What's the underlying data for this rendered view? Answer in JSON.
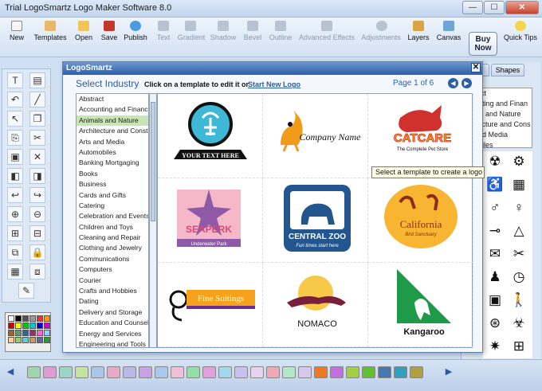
{
  "window": {
    "title": "Trial LogoSmartz Logo Maker Software 8.0",
    "min": "—",
    "max": "☐",
    "close": "✕"
  },
  "toolbar": {
    "items": [
      {
        "label": "New",
        "enabled": true
      },
      {
        "label": "Templates",
        "enabled": true
      },
      {
        "label": "Open",
        "enabled": true
      },
      {
        "label": "Save",
        "enabled": true
      },
      {
        "label": "Publish",
        "enabled": true
      },
      {
        "label": "Text",
        "enabled": false
      },
      {
        "label": "Gradient",
        "enabled": false
      },
      {
        "label": "Shadow",
        "enabled": false
      },
      {
        "label": "Bevel",
        "enabled": false
      },
      {
        "label": "Outline",
        "enabled": false
      },
      {
        "label": "Advanced Effects",
        "enabled": false
      },
      {
        "label": "Adjustments",
        "enabled": false
      },
      {
        "label": "Layers",
        "enabled": true
      },
      {
        "label": "Canvas",
        "enabled": true
      }
    ],
    "buy_now": "Buy Now",
    "quick_tips": "Quick Tips"
  },
  "right_panel": {
    "tab_shapes": "Shapes",
    "categories": [
      "ract",
      "unting and Finan",
      "als and Nature",
      "itecture and Cons",
      "and Media",
      "obiles"
    ],
    "symbols": [
      "☢",
      "⚙",
      "♿",
      "▦",
      "♂",
      "♀",
      "⊸",
      "△",
      "✉",
      "✂",
      "♟",
      "◷",
      "▣",
      "🚶",
      "⊛",
      "☣",
      "✷",
      "⊞"
    ]
  },
  "dialog": {
    "title": "LogoSmartz",
    "close": "✕",
    "heading": "Select Industry",
    "subtext": "Click on a template to edit it or",
    "start_new": "Start New Logo",
    "page": "Page 1 of 6",
    "prev": "◀",
    "next": "▶",
    "industries": [
      "Abstract",
      "Accounting and Finance",
      "Animals and Nature",
      "Architecture and Constr",
      "Arts and Media",
      "Automobiles",
      "Banking Mortgaging",
      "Books",
      "Business",
      "Cards and Gifts",
      "Catering",
      "Celebration and Events",
      "Children and Toys",
      "Cleaning and Repair",
      "Clothing and Jewelry",
      "Communications",
      "Computers",
      "Courier",
      "Crafts and Hobbies",
      "Dating",
      "Delivery and Storage",
      "Education and Counsel",
      "Energy and Services",
      "Engineering and Tools"
    ],
    "selected_index": 2,
    "tooltip": "Select a template to create a logo",
    "templates": [
      {
        "text": "YOUR TEXT HERE"
      },
      {
        "text": "Company Name"
      },
      {
        "text": "CATCARE",
        "tagline": "The Complete Pet Store"
      },
      {
        "text": "SEAPERK",
        "tagline": "Underwater Park"
      },
      {
        "text": "CENTRAL ZOO",
        "tagline": "Fun times start here"
      },
      {
        "text": "California",
        "tagline": "Bird Sanctuary"
      },
      {
        "text": "Fine Suitings"
      },
      {
        "text": "NOMACO"
      },
      {
        "text": "Kangaroo"
      }
    ]
  },
  "colors": {
    "accent": "#2d5fa7",
    "selected": "#c9e5b4"
  }
}
